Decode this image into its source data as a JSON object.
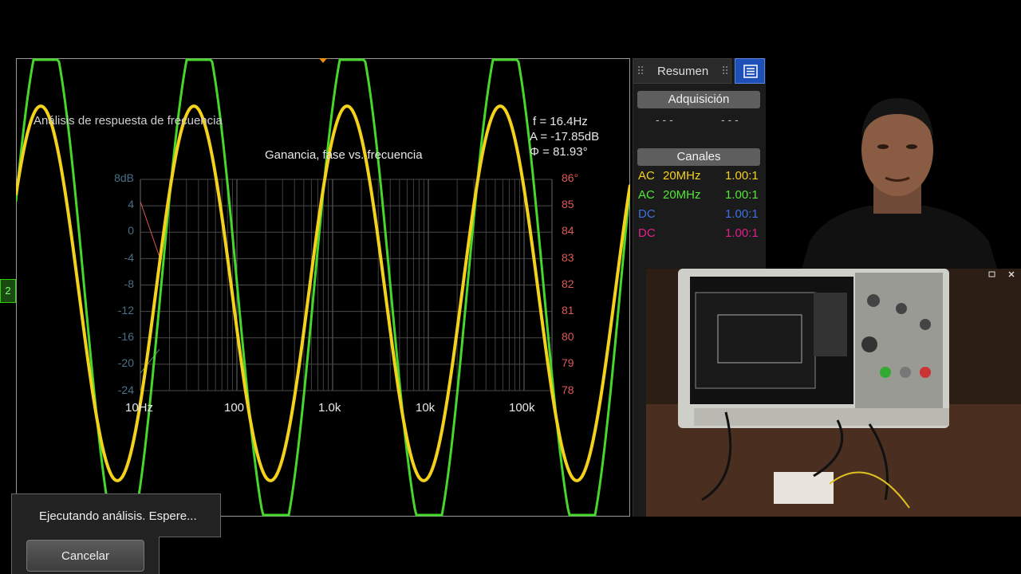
{
  "analysis_title": "Análisis de respuesta de frecuencia",
  "plot_title": "Ganancia, fase vs. frecuencia",
  "readout": {
    "f": "f = 16.4Hz",
    "a": "A = -17.85dB",
    "phi": "Φ = 81.93°"
  },
  "left_axis_ticks": [
    "8dB",
    "4",
    "0",
    "-4",
    "-8",
    "-12",
    "-16",
    "-20",
    "-24"
  ],
  "right_axis_ticks": [
    "86°",
    "85",
    "84",
    "83",
    "82",
    "81",
    "80",
    "79",
    "78"
  ],
  "x_axis_ticks": [
    "10Hz",
    "100",
    "1.0k",
    "10k",
    "100k"
  ],
  "channel_marker": "2",
  "side_panel": {
    "tab_label": "Resumen",
    "acquisition_label": "Adquisición",
    "acquisition_values": [
      "- - -",
      "- - -"
    ],
    "channels_label": "Canales",
    "channels": [
      {
        "coupling": "AC",
        "bw": "20MHz",
        "probe": "1.00:1",
        "color": "#f4d11c"
      },
      {
        "coupling": "AC",
        "bw": "20MHz",
        "probe": "1.00:1",
        "color": "#55e43a"
      },
      {
        "coupling": "DC",
        "bw": "",
        "probe": "1.00:1",
        "color": "#3f6fe0"
      },
      {
        "coupling": "DC",
        "bw": "",
        "probe": "1.00:1",
        "color": "#e0208a"
      }
    ]
  },
  "dialog": {
    "message": "Ejecutando análisis. Espere...",
    "cancel_label": "Cancelar"
  },
  "colors": {
    "ch1": "#f4d11c",
    "ch2": "#47d62c",
    "grid": "#555555",
    "gain_axis": "#4a6f86",
    "phase_axis": "#e05858"
  }
}
